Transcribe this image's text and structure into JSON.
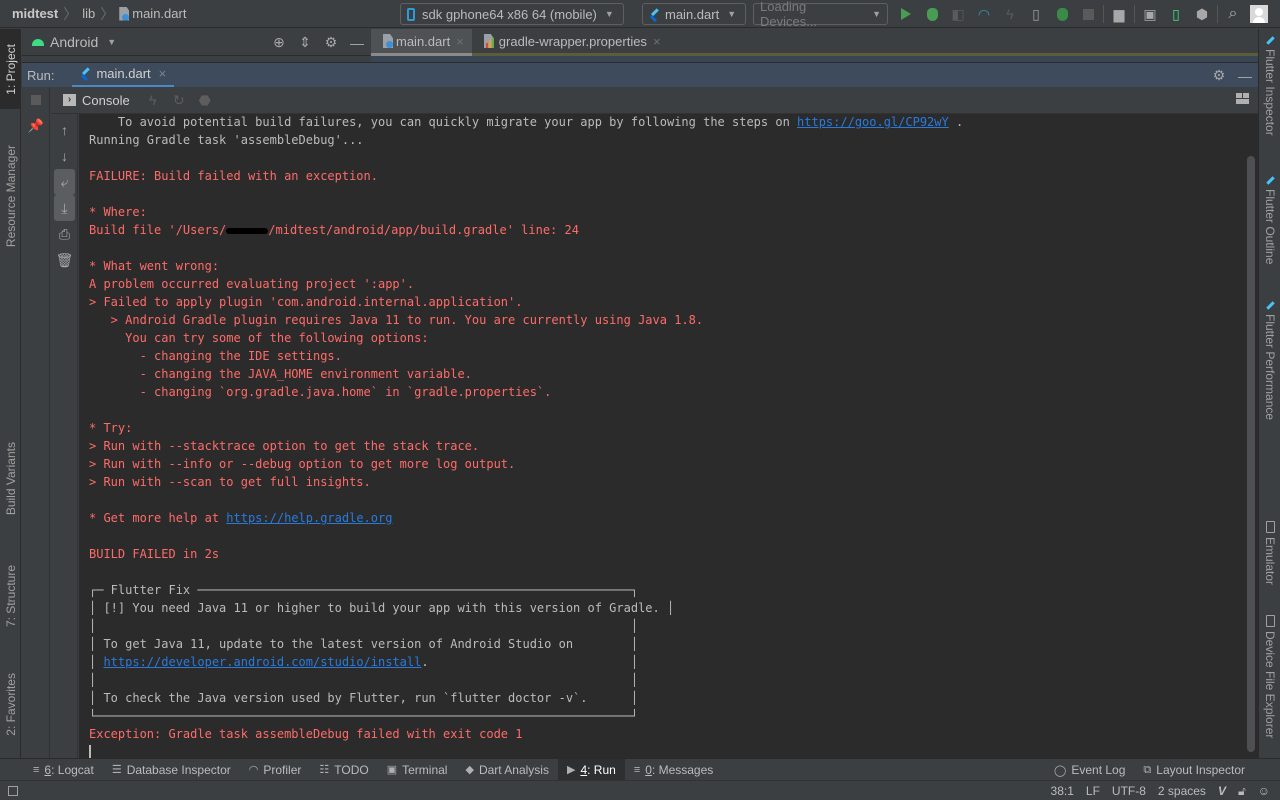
{
  "navbar": {
    "breadcrumb": [
      "midtest",
      "lib",
      "main.dart"
    ],
    "device_selector": "sdk gphone64 x86 64 (mobile)",
    "run_config": "main.dart",
    "devices_dropdown": "Loading Devices...",
    "toolbar_icons": [
      "run-icon",
      "debug-icon",
      "attach-debugger-icon",
      "profile-icon",
      "apply-changes-icon",
      "flutter-hot-reload-icon",
      "attach-icon",
      "stop-icon",
      "project-structure-icon",
      "avd-manager-icon",
      "device-manager-icon",
      "sdk-manager-icon",
      "search-icon",
      "account-icon"
    ]
  },
  "left_strip": {
    "tabs": [
      {
        "label": "1: Project",
        "active": true
      },
      {
        "label": "Resource Manager",
        "active": false
      },
      {
        "label": "Build Variants",
        "active": false
      },
      {
        "label": "7: Structure",
        "active": false
      },
      {
        "label": "2: Favorites",
        "active": false
      }
    ]
  },
  "right_strip": {
    "tabs": [
      {
        "label": "Flutter Inspector"
      },
      {
        "label": "Flutter Outline"
      },
      {
        "label": "Flutter Performance"
      },
      {
        "label": "Emulator"
      },
      {
        "label": "Device File Explorer"
      }
    ]
  },
  "project_panel": {
    "view": "Android"
  },
  "editor_tabs": [
    {
      "label": "main.dart",
      "active": true
    },
    {
      "label": "gradle-wrapper.properties",
      "active": false
    }
  ],
  "run_panel": {
    "label": "Run:",
    "tab": "main.dart",
    "console_tab": "Console"
  },
  "console": {
    "lines": [
      {
        "type": "n",
        "text": "    To avoid potential build failures, you can quickly migrate your app by following the steps on ",
        "link": "https://goo.gl/CP92wY",
        "after": " ."
      },
      {
        "type": "n",
        "text": "Running Gradle task 'assembleDebug'..."
      },
      {
        "type": "blank",
        "text": ""
      },
      {
        "type": "e",
        "text": "FAILURE: Build failed with an exception."
      },
      {
        "type": "blank",
        "text": ""
      },
      {
        "type": "e",
        "text": "* Where:"
      },
      {
        "type": "e",
        "text": "Build file '/Users/",
        "redacted": true,
        "after": "/midtest/android/app/build.gradle' line: 24"
      },
      {
        "type": "blank",
        "text": ""
      },
      {
        "type": "e",
        "text": "* What went wrong:"
      },
      {
        "type": "e",
        "text": "A problem occurred evaluating project ':app'."
      },
      {
        "type": "e",
        "text": "> Failed to apply plugin 'com.android.internal.application'."
      },
      {
        "type": "e",
        "text": "   > Android Gradle plugin requires Java 11 to run. You are currently using Java 1.8."
      },
      {
        "type": "e",
        "text": "     You can try some of the following options:"
      },
      {
        "type": "e",
        "text": "       - changing the IDE settings."
      },
      {
        "type": "e",
        "text": "       - changing the JAVA_HOME environment variable."
      },
      {
        "type": "e",
        "text": "       - changing `org.gradle.java.home` in `gradle.properties`."
      },
      {
        "type": "blank",
        "text": ""
      },
      {
        "type": "e",
        "text": "* Try:"
      },
      {
        "type": "e",
        "text": "> Run with --stacktrace option to get the stack trace."
      },
      {
        "type": "e",
        "text": "> Run with --info or --debug option to get more log output."
      },
      {
        "type": "e",
        "text": "> Run with --scan to get full insights."
      },
      {
        "type": "blank",
        "text": ""
      },
      {
        "type": "e",
        "text": "* Get more help at ",
        "link": "https://help.gradle.org",
        "after": ""
      },
      {
        "type": "blank",
        "text": ""
      },
      {
        "type": "e",
        "text": "BUILD FAILED in 2s"
      },
      {
        "type": "blank",
        "text": ""
      },
      {
        "type": "n",
        "text": "┌─ Flutter Fix ────────────────────────────────────────────────────────────┐"
      },
      {
        "type": "n",
        "text": "│ [!] You need Java 11 or higher to build your app with this version of Gradle. │"
      },
      {
        "type": "n",
        "text": "│                                                                          │"
      },
      {
        "type": "n",
        "text": "│ To get Java 11, update to the latest version of Android Studio on        │"
      },
      {
        "type": "n",
        "text": "│ ",
        "link": "https://developer.android.com/studio/install",
        "after": ".                            │"
      },
      {
        "type": "n",
        "text": "│                                                                          │"
      },
      {
        "type": "n",
        "text": "│ To check the Java version used by Flutter, run `flutter doctor -v`.      │"
      },
      {
        "type": "n",
        "text": "└──────────────────────────────────────────────────────────────────────────┘"
      },
      {
        "type": "e",
        "text": "Exception: Gradle task assembleDebug failed with exit code 1"
      },
      {
        "type": "cursor",
        "text": ""
      }
    ]
  },
  "bottom_tabs": {
    "left": [
      {
        "mnemonic": "6",
        "label": ": Logcat",
        "icon": "logcat-icon",
        "active": false
      },
      {
        "mnemonic": "",
        "label": "Database Inspector",
        "icon": "database-icon",
        "active": false
      },
      {
        "mnemonic": "",
        "label": "Profiler",
        "icon": "profiler-icon",
        "active": false
      },
      {
        "mnemonic": "",
        "label": "TODO",
        "icon": "todo-icon",
        "active": false
      },
      {
        "mnemonic": "",
        "label": "Terminal",
        "icon": "terminal-icon",
        "active": false
      },
      {
        "mnemonic": "",
        "label": "Dart Analysis",
        "icon": "dart-analysis-icon",
        "active": false
      },
      {
        "mnemonic": "4",
        "label": ": Run",
        "icon": "run-icon",
        "active": true
      },
      {
        "mnemonic": "0",
        "label": ": Messages",
        "icon": "messages-icon",
        "active": false
      }
    ],
    "right": [
      {
        "label": "Event Log",
        "icon": "event-log-icon"
      },
      {
        "label": "Layout Inspector",
        "icon": "layout-inspector-icon"
      }
    ]
  },
  "status_bar": {
    "position": "38:1",
    "line_separator": "LF",
    "encoding": "UTF-8",
    "indent": "2 spaces"
  },
  "colors": {
    "error_text": "#ff6b68",
    "normal_text": "#bbbbbb",
    "link": "#287bde",
    "console_bg": "#2b2b2b",
    "run_header_bg": "#3d4b5c",
    "run_tab_underline": "#4a88c7"
  }
}
